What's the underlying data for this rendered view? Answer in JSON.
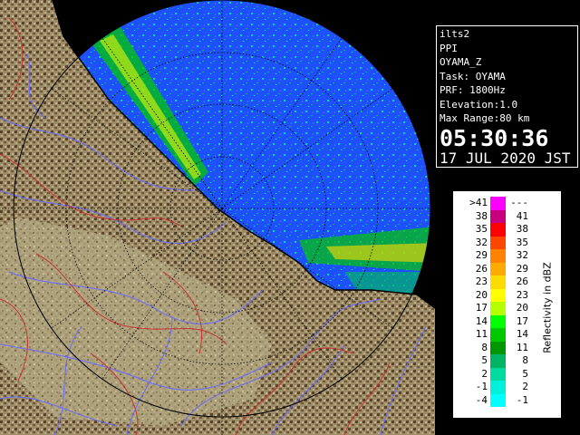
{
  "product": {
    "site_id": "ilts2",
    "scan_type": "PPI",
    "radar_name": "OYAMA_Z",
    "task": "Task: OYAMA",
    "prf": "PRF: 1800Hz",
    "elevation": "Elevation:1.0",
    "max_range": "Max Range:80 km",
    "time": "05:30:36",
    "date": "17 JUL 2020 JST"
  },
  "legend": {
    "title": "Reflectivity in dBZ",
    "rows": [
      {
        "lo": ">41",
        "hi": "---",
        "color": "#ff00ff"
      },
      {
        "lo": "38",
        "hi": "41",
        "color": "#c8007d"
      },
      {
        "lo": "35",
        "hi": "38",
        "color": "#ff0000"
      },
      {
        "lo": "32",
        "hi": "35",
        "color": "#ff4600"
      },
      {
        "lo": "29",
        "hi": "32",
        "color": "#ff8200"
      },
      {
        "lo": "26",
        "hi": "29",
        "color": "#ffaa00"
      },
      {
        "lo": "23",
        "hi": "26",
        "color": "#ffdc00"
      },
      {
        "lo": "20",
        "hi": "23",
        "color": "#ffff00"
      },
      {
        "lo": "17",
        "hi": "20",
        "color": "#b4ff00"
      },
      {
        "lo": "14",
        "hi": "17",
        "color": "#00ff00"
      },
      {
        "lo": "11",
        "hi": "14",
        "color": "#00c800"
      },
      {
        "lo": "8",
        "hi": "11",
        "color": "#009600"
      },
      {
        "lo": "5",
        "hi": "8",
        "color": "#00b464"
      },
      {
        "lo": "2",
        "hi": "5",
        "color": "#00dca0"
      },
      {
        "lo": "-1",
        "hi": "2",
        "color": "#00f0dc"
      },
      {
        "lo": "-4",
        "hi": "-1",
        "color": "#00ffff"
      }
    ]
  },
  "map_colors": {
    "echo_background": "#1e50ff",
    "land_light": "#a89c78",
    "land_dark": "#5a4428",
    "rivers": "#6a6aff",
    "boundaries": "#c83232",
    "range_rings": "#000000"
  }
}
